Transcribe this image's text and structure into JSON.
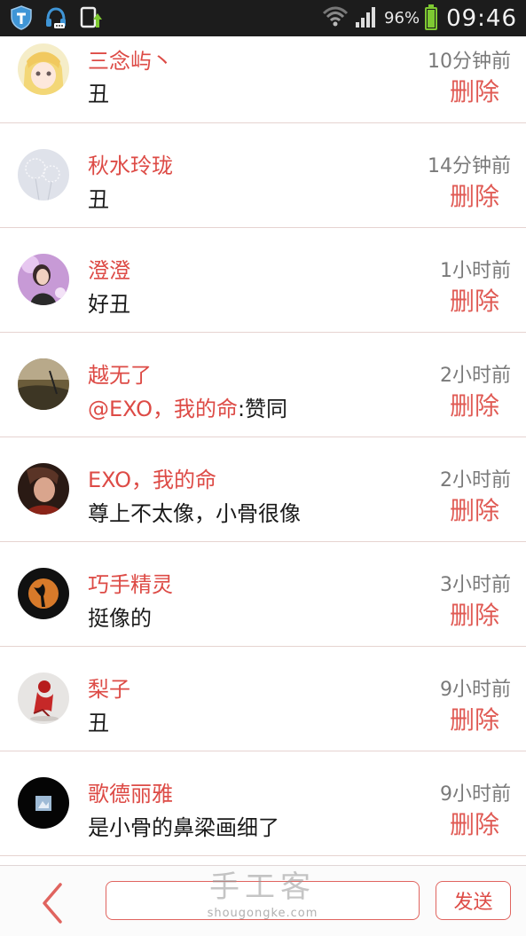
{
  "status_bar": {
    "icons": [
      "shield-icon",
      "headset-icon",
      "phone-update-icon",
      "wifi-icon",
      "signal-icon"
    ],
    "battery_percent": "96%",
    "battery_level": 0.96,
    "time": "09:46",
    "colors": {
      "background": "#1c1c1c",
      "battery": "#7ec932",
      "shield": "#3f95d6"
    }
  },
  "comments": [
    {
      "name": "三念屿丶",
      "mention": "",
      "text": "丑",
      "time": "10分钟前",
      "delete": "删除",
      "avatar": "anime-girl-avatar"
    },
    {
      "name": "秋水玲珑",
      "mention": "",
      "text": "丑",
      "time": "14分钟前",
      "delete": "删除",
      "avatar": "dandelion-avatar"
    },
    {
      "name": "澄澄",
      "mention": "",
      "text": "好丑",
      "time": "1小时前",
      "delete": "删除",
      "avatar": "girl-photo-avatar"
    },
    {
      "name": "越无了",
      "mention": "@EXO，我的命",
      "text": ":赞同",
      "time": "2小时前",
      "delete": "删除",
      "avatar": "landscape-avatar"
    },
    {
      "name": "EXO，我的命",
      "mention": "",
      "text": "尊上不太像，小骨很像",
      "time": "2小时前",
      "delete": "删除",
      "avatar": "person-photo-avatar"
    },
    {
      "name": "巧手精灵",
      "mention": "",
      "text": "挺像的",
      "time": "3小时前",
      "delete": "删除",
      "avatar": "fairy-silhouette-avatar"
    },
    {
      "name": "梨子",
      "mention": "",
      "text": "丑",
      "time": "9小时前",
      "delete": "删除",
      "avatar": "red-figure-avatar"
    },
    {
      "name": "歌德丽雅",
      "mention": "",
      "text": "是小骨的鼻梁画细了",
      "time": "9小时前",
      "delete": "删除",
      "avatar": "black-avatar"
    }
  ],
  "bottom_bar": {
    "input_value": "",
    "input_placeholder": "",
    "send_label": "发送",
    "back_icon": "chevron-left-icon"
  },
  "watermark": {
    "title": "手工客",
    "url": "shougongke.com"
  },
  "colors": {
    "accent": "#dd4b46",
    "divider": "#e6d3d0",
    "time_text": "#7a7a7a"
  }
}
